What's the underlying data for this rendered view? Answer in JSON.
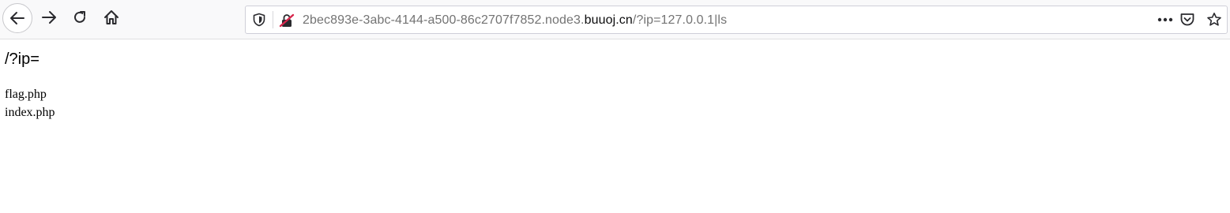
{
  "browser": {
    "url": {
      "prefix": "2bec893e-3abc-4144-a500-86c2707f7852.node3.",
      "domain": "buuoj.cn",
      "path": "/?ip=127.0.0.1|ls"
    },
    "icons": {
      "back": "back-arrow-icon",
      "forward": "forward-arrow-icon",
      "reload": "reload-icon",
      "home": "home-icon",
      "tracking": "tracking-protection-shield-icon",
      "insecure": "insecure-connection-lock-icon",
      "more": "more-actions-icon",
      "pocket": "pocket-icon",
      "bookmark": "bookmark-star-icon"
    },
    "accent_colors": {
      "insecure": "#d7264c",
      "domain_text": "#0c0c0d",
      "url_text": "#737373"
    }
  },
  "page": {
    "prompt": "/?ip=",
    "output": [
      "flag.php",
      "index.php"
    ]
  }
}
